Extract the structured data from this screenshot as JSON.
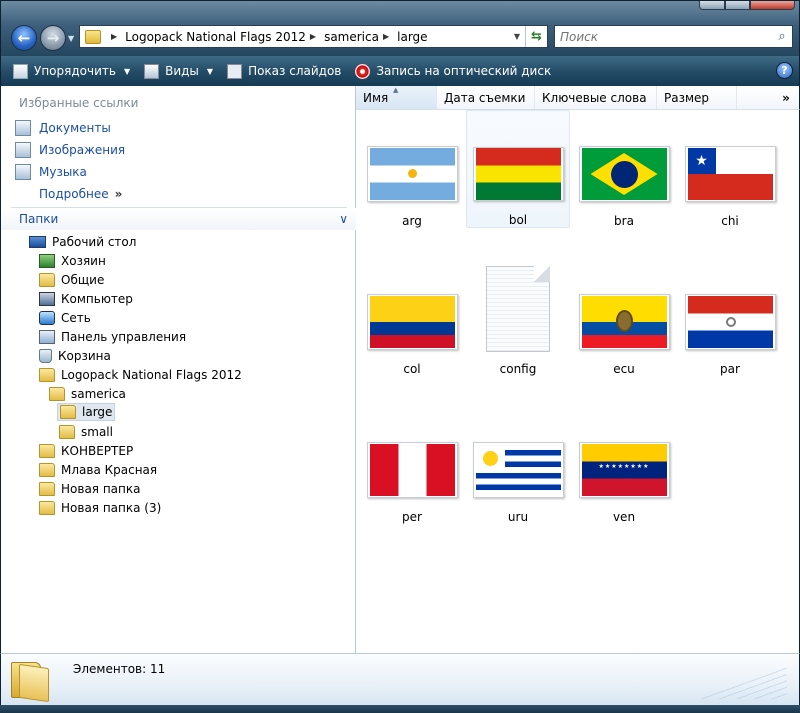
{
  "window": {
    "breadcrumbs": [
      "Logopack National Flags 2012",
      "samerica",
      "large"
    ],
    "search_placeholder": "Поиск"
  },
  "toolbar": {
    "organize": "Упорядочить",
    "views": "Виды",
    "slideshow": "Показ слайдов",
    "burn": "Запись на оптический диск"
  },
  "favorites": {
    "header": "Избранные ссылки",
    "items": [
      "Документы",
      "Изображения",
      "Музыка"
    ],
    "more": "Подробнее"
  },
  "folders": {
    "header": "Папки",
    "tree": [
      {
        "label": "Рабочий стол",
        "icon": "desktop-icon"
      },
      {
        "label": "Хозяин",
        "icon": "user-icon"
      },
      {
        "label": "Общие",
        "icon": "folder-icon"
      },
      {
        "label": "Компьютер",
        "icon": "computer-icon"
      },
      {
        "label": "Сеть",
        "icon": "network-icon"
      },
      {
        "label": "Панель управления",
        "icon": "control-panel-icon"
      },
      {
        "label": "Корзина",
        "icon": "recycle-bin-icon"
      },
      {
        "label": "Logopack National Flags 2012",
        "icon": "folder-icon"
      },
      {
        "label": "samerica",
        "icon": "folder-icon"
      },
      {
        "label": "large",
        "icon": "folder-icon"
      },
      {
        "label": "small",
        "icon": "folder-icon"
      },
      {
        "label": "КОНВЕРТЕР",
        "icon": "folder-icon"
      },
      {
        "label": "Млава Красная",
        "icon": "folder-icon"
      },
      {
        "label": "Новая папка",
        "icon": "folder-icon"
      },
      {
        "label": "Новая папка (3)",
        "icon": "folder-icon"
      }
    ]
  },
  "columns": [
    "Имя",
    "Дата съемки",
    "Ключевые слова",
    "Размер"
  ],
  "files": [
    {
      "name": "arg",
      "flag": "argentina"
    },
    {
      "name": "bol",
      "flag": "bolivia"
    },
    {
      "name": "bra",
      "flag": "brazil"
    },
    {
      "name": "chi",
      "flag": "chile"
    },
    {
      "name": "col",
      "flag": "colombia"
    },
    {
      "name": "config",
      "flag": "document"
    },
    {
      "name": "ecu",
      "flag": "ecuador"
    },
    {
      "name": "par",
      "flag": "paraguay"
    },
    {
      "name": "per",
      "flag": "peru"
    },
    {
      "name": "uru",
      "flag": "uruguay"
    },
    {
      "name": "ven",
      "flag": "venezuela"
    }
  ],
  "details": {
    "item_count": "Элементов: 11"
  }
}
